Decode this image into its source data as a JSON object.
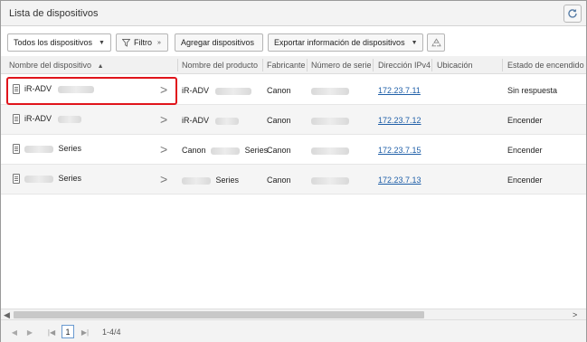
{
  "window": {
    "title": "Lista de dispositivos"
  },
  "toolbar": {
    "view_select": "Todos los dispositivos",
    "filter_label": "Filtro",
    "add_label": "Agregar dispositivos",
    "export_label": "Exportar información de dispositivos"
  },
  "columns": {
    "name": "Nombre del dispositivo",
    "product": "Nombre del producto",
    "maker": "Fabricante",
    "serial": "Número de serie",
    "ipv4": "Dirección IPv4",
    "location": "Ubicación",
    "power": "Estado de encendido"
  },
  "rows": [
    {
      "name": "iR-ADV",
      "product": "iR-ADV",
      "maker": "Canon",
      "ipv4": "172.23.7.11",
      "power": "Sin respuesta"
    },
    {
      "name": "iR-ADV",
      "product": "iR-ADV",
      "maker": "Canon",
      "ipv4": "172.23.7.12",
      "power": "Encender"
    },
    {
      "name": "Series",
      "product_prefix": "Canon",
      "product": "Series",
      "maker": "Canon",
      "ipv4": "172.23.7.15",
      "power": "Encender"
    },
    {
      "name": "Series",
      "product": "Series",
      "maker": "Canon",
      "ipv4": "172.23.7.13",
      "power": "Encender"
    }
  ],
  "pager": {
    "current_page": "1",
    "count": "1-4/4"
  },
  "icons": [
    "refresh-icon",
    "filter-icon",
    "recycle-icon",
    "sort-asc-icon",
    "device-icon",
    "chevron-right-icon",
    "first-page-icon",
    "prev-page-icon",
    "next-page-icon",
    "last-page-icon"
  ],
  "colors": {
    "highlight": "#e0141b",
    "link": "#1f5fa8"
  }
}
